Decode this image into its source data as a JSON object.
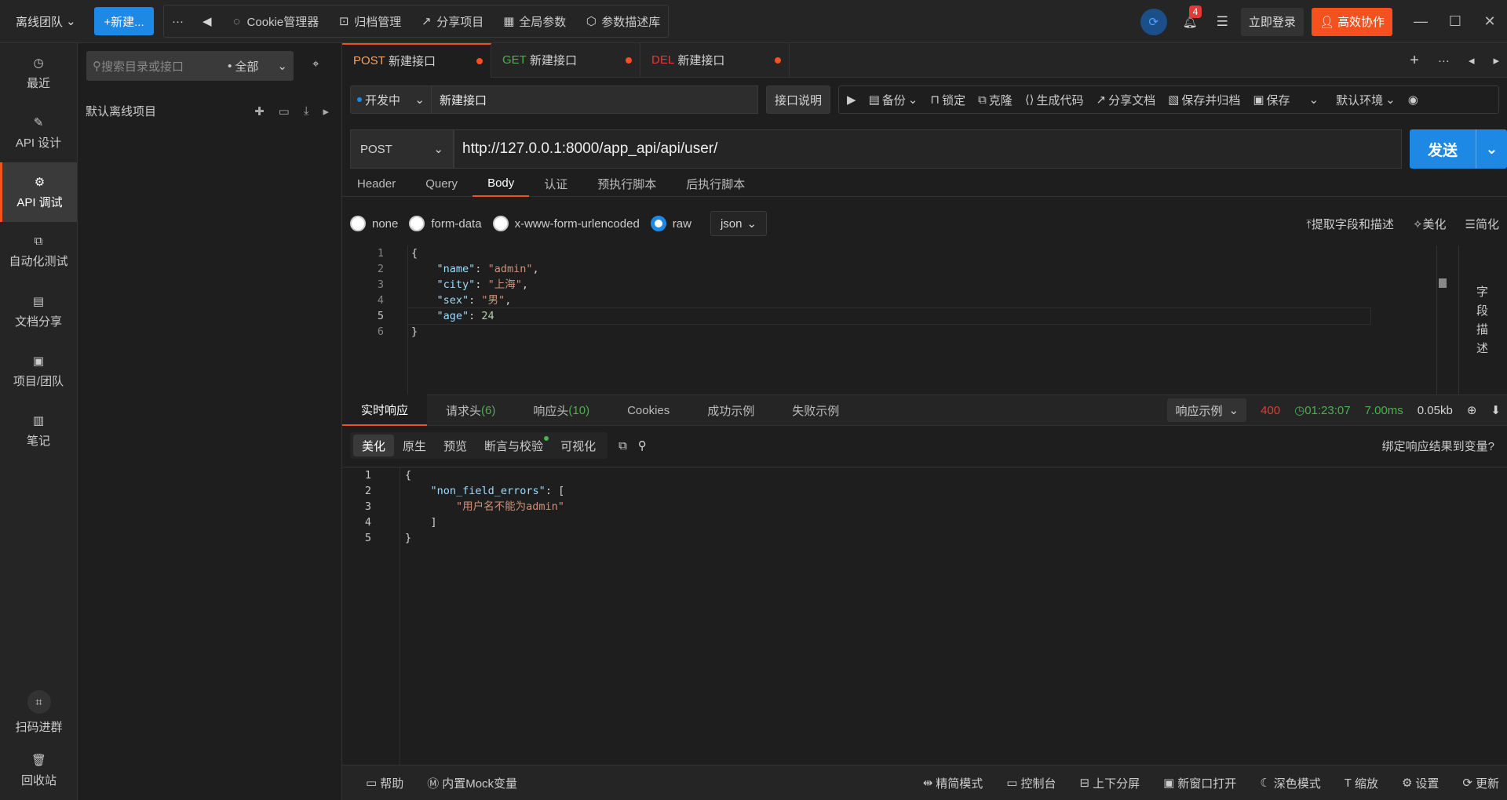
{
  "topbar": {
    "team": "离线团队",
    "new_label": "+新建...",
    "more": "···",
    "back": "◀",
    "items": [
      {
        "icon": "cookie-icon",
        "label": "Cookie管理器"
      },
      {
        "icon": "archive-icon",
        "label": "归档管理"
      },
      {
        "icon": "share-icon",
        "label": "分享项目"
      },
      {
        "icon": "params-icon",
        "label": "全局参数"
      },
      {
        "icon": "library-icon",
        "label": "参数描述库"
      }
    ],
    "badge": "4",
    "login": "立即登录",
    "collab": "高效协作"
  },
  "nav": {
    "items": [
      "最近",
      "API 设计",
      "API 调试",
      "自动化测试",
      "文档分享",
      "项目/团队",
      "笔记"
    ],
    "qr": "扫码进群",
    "trash": "回收站"
  },
  "tree": {
    "search_placeholder": "搜索目录或接口",
    "scope": "全部",
    "project": "默认离线项目"
  },
  "tabs": [
    {
      "method": "POST",
      "name": "新建接口",
      "color": "#f4a261"
    },
    {
      "method": "GET",
      "name": "新建接口",
      "color": "#4caf50"
    },
    {
      "method": "DEL",
      "name": "新建接口",
      "color": "#e53935"
    }
  ],
  "request": {
    "env": "开发中",
    "name": "新建接口",
    "desc_btn": "接口说明",
    "tools": [
      "备份",
      "锁定",
      "克隆",
      "生成代码",
      "分享文档",
      "保存并归档",
      "保存"
    ],
    "env_select": "默认环境",
    "method": "POST",
    "url": "http://127.0.0.1:8000/app_api/api/user/",
    "send": "发送"
  },
  "req_tabs": [
    "Header",
    "Query",
    "Body",
    "认证",
    "预执行脚本",
    "后执行脚本"
  ],
  "body": {
    "options": [
      "none",
      "form-data",
      "x-www-form-urlencoded",
      "raw"
    ],
    "format": "json",
    "extract": "提取字段和描述",
    "beautify": "美化",
    "simplify": "简化",
    "field_desc": [
      "字",
      "段",
      "描",
      "述"
    ],
    "lines": [
      "{",
      "    \"name\": \"admin\",",
      "    \"city\": \"上海\",",
      "    \"sex\": \"男\",",
      "    \"age\": 24",
      "}"
    ]
  },
  "response": {
    "tabs": [
      "实时响应",
      "请求头",
      "响应头",
      "Cookies",
      "成功示例",
      "失败示例"
    ],
    "req_count": "(6)",
    "resp_count": "(10)",
    "example_select": "响应示例",
    "status": "400",
    "time": "01:23:07",
    "duration": "7.00ms",
    "size": "0.05kb",
    "views": [
      "美化",
      "原生",
      "预览",
      "断言与校验",
      "可视化"
    ],
    "bind": "绑定响应结果到变量?",
    "lines": [
      "{",
      "    \"non_field_errors\": [",
      "        \"用户名不能为admin\"",
      "    ]",
      "}"
    ]
  },
  "statusbar": {
    "left": [
      "帮助",
      "内置Mock变量"
    ],
    "right": [
      "精简模式",
      "控制台",
      "上下分屏",
      "新窗口打开",
      "深色模式",
      "缩放",
      "设置",
      "更新"
    ]
  }
}
